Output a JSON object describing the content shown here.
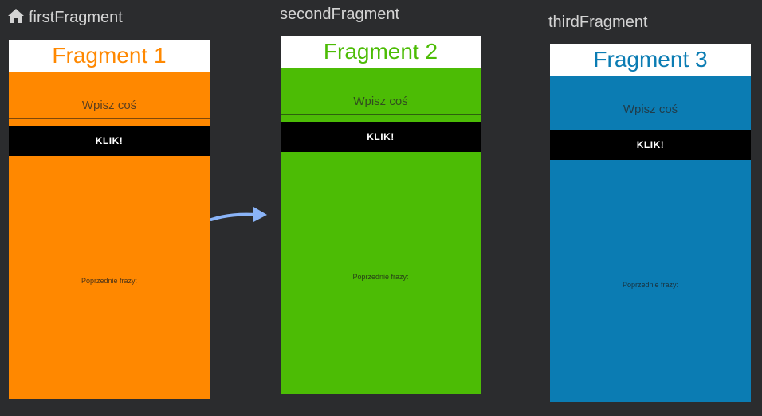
{
  "graph": {
    "start_icon": "home-icon",
    "arrow_color": "#8ab4f8",
    "destinations": [
      {
        "label": "firstFragment",
        "is_start": true,
        "header": "Fragment 1",
        "header_color": "#ff8800",
        "background": "#ff8800",
        "input_hint": "Wpisz coś",
        "button_label": "KLIK!",
        "prev_label": "Poprzednie frazy:"
      },
      {
        "label": "secondFragment",
        "is_start": false,
        "header": "Fragment 2",
        "header_color": "#4cbc05",
        "background": "#4cbc05",
        "input_hint": "Wpisz coś",
        "button_label": "KLIK!",
        "prev_label": "Poprzednie frazy:"
      },
      {
        "label": "thirdFragment",
        "is_start": false,
        "header": "Fragment 3",
        "header_color": "#0b7cb3",
        "background": "#0b7cb3",
        "input_hint": "Wpisz coś",
        "button_label": "KLIK!",
        "prev_label": "Poprzednie frazy:"
      }
    ]
  }
}
